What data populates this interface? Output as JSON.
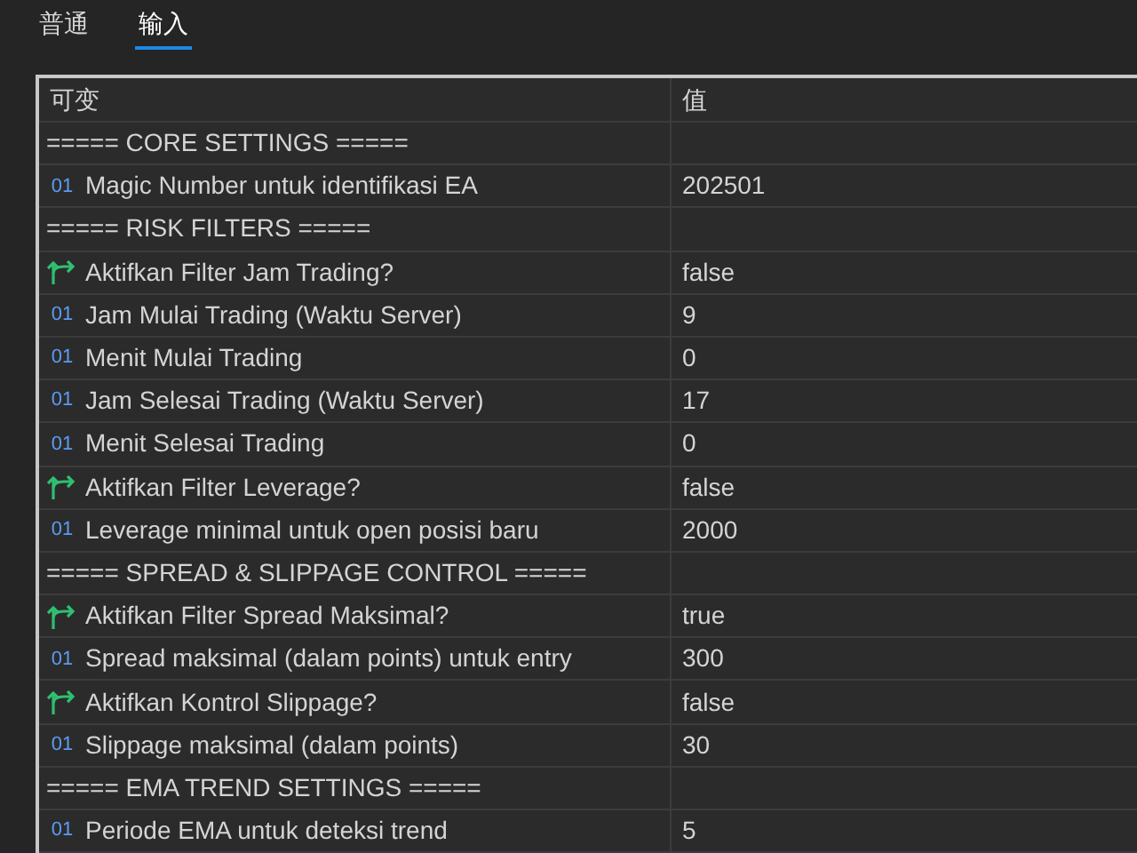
{
  "tabs": [
    {
      "label": "普通",
      "selected": false
    },
    {
      "label": "输入",
      "selected": true
    }
  ],
  "table": {
    "columns": [
      "可变",
      "值"
    ],
    "rows": [
      {
        "kind": "section",
        "name": "===== CORE SETTINGS =====",
        "value": ""
      },
      {
        "kind": "int",
        "icon": "01",
        "name": "Magic Number untuk identifikasi EA",
        "value": "202501"
      },
      {
        "kind": "section",
        "name": "===== RISK FILTERS =====",
        "value": ""
      },
      {
        "kind": "bool",
        "name": "Aktifkan Filter Jam Trading?",
        "value": "false"
      },
      {
        "kind": "int",
        "icon": "01",
        "name": "Jam Mulai Trading (Waktu Server)",
        "value": "9"
      },
      {
        "kind": "int",
        "icon": "01",
        "name": "Menit Mulai Trading",
        "value": "0"
      },
      {
        "kind": "int",
        "icon": "01",
        "name": "Jam Selesai Trading (Waktu Server)",
        "value": "17"
      },
      {
        "kind": "int",
        "icon": "01",
        "name": "Menit Selesai Trading",
        "value": "0"
      },
      {
        "kind": "bool",
        "name": "Aktifkan Filter Leverage?",
        "value": "false"
      },
      {
        "kind": "int",
        "icon": "01",
        "name": "Leverage minimal untuk open posisi baru",
        "value": "2000"
      },
      {
        "kind": "section",
        "name": "===== SPREAD & SLIPPAGE CONTROL =====",
        "value": ""
      },
      {
        "kind": "bool",
        "name": "Aktifkan Filter Spread Maksimal?",
        "value": "true"
      },
      {
        "kind": "int",
        "icon": "01",
        "name": "Spread maksimal (dalam points) untuk entry",
        "value": "300"
      },
      {
        "kind": "bool",
        "name": "Aktifkan Kontrol Slippage?",
        "value": "false"
      },
      {
        "kind": "int",
        "icon": "01",
        "name": "Slippage maksimal (dalam points)",
        "value": "30"
      },
      {
        "kind": "section",
        "name": "===== EMA TREND SETTINGS =====",
        "value": ""
      },
      {
        "kind": "int",
        "icon": "01",
        "name": "Periode EMA untuk deteksi trend",
        "value": "5"
      }
    ]
  }
}
